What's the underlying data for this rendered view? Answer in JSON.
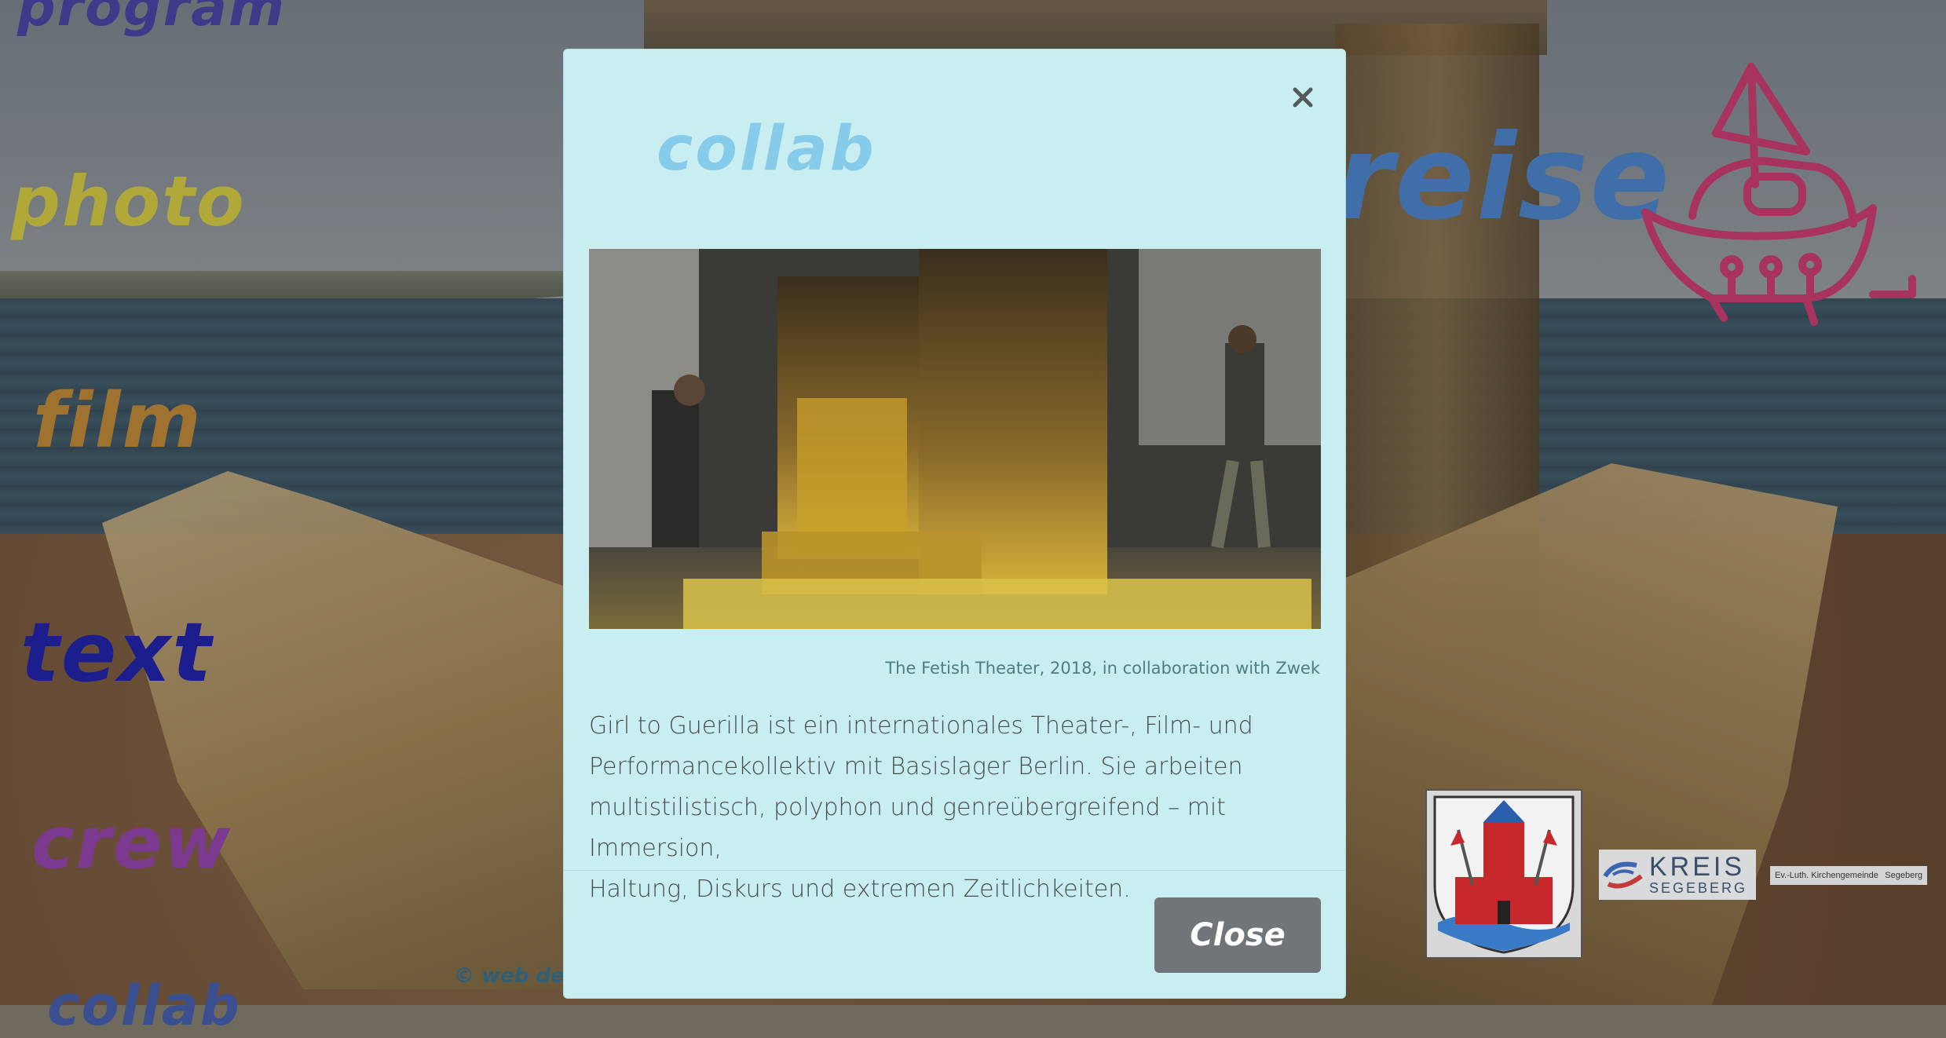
{
  "nav": {
    "program": "program",
    "photo": "photo",
    "film": "film",
    "text": "text",
    "crew": "crew",
    "collab": "collab",
    "reise": "reise"
  },
  "footer": {
    "credit": "© web des"
  },
  "sponsors": {
    "kreis_main": "KREIS",
    "kreis_sub": "SEGEBERG",
    "church_left": "Ev.-Luth. Kirchengemeinde",
    "church_right": "Segeberg"
  },
  "modal": {
    "title": "collab",
    "close_icon": "close-icon",
    "image_alt": "Theater stage with large painted wooden blocks",
    "caption": "The Fetish Theater, 2018, in collaboration with Zwek",
    "body_lines": [
      "Girl to Guerilla ist ein internationales Theater-, Film- und",
      "Performancekollektiv mit Basislager Berlin. Sie arbeiten",
      "multistilistisch, polyphon und genreübergreifend – mit Immersion,",
      "Haltung, Diskurs und extremen Zeitlichkeiten."
    ],
    "close_button_label": "Close"
  },
  "colors": {
    "modal_bg": "#c9eef1",
    "title": "#86cbe9",
    "close_button": "#70757a",
    "boat_doodle": "#a8335e"
  }
}
